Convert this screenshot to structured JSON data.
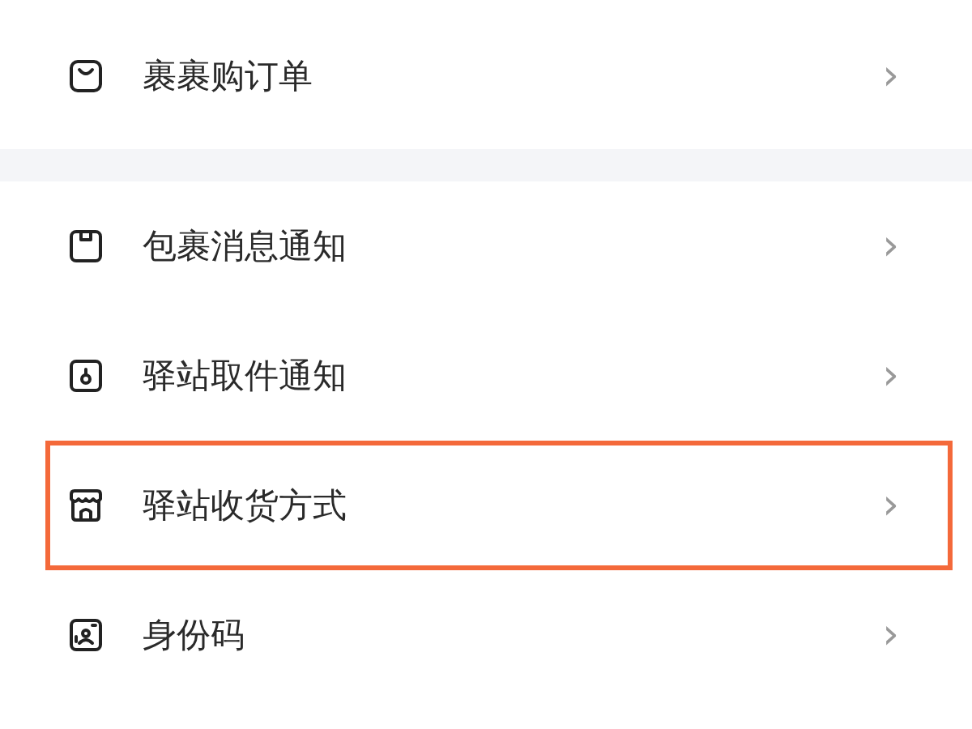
{
  "groups": [
    {
      "items": [
        {
          "kind": "bag",
          "label": "裹裹购订单",
          "chevron": "›",
          "highlighted": false
        }
      ]
    },
    {
      "items": [
        {
          "kind": "box",
          "label": "包裹消息通知",
          "chevron": "›",
          "highlighted": false
        },
        {
          "kind": "pin",
          "label": "驿站取件通知",
          "chevron": "›",
          "highlighted": false
        },
        {
          "kind": "store",
          "label": "驿站收货方式",
          "chevron": "›",
          "highlighted": true
        },
        {
          "kind": "idcode",
          "label": "身份码",
          "chevron": "›",
          "highlighted": false
        }
      ]
    }
  ]
}
